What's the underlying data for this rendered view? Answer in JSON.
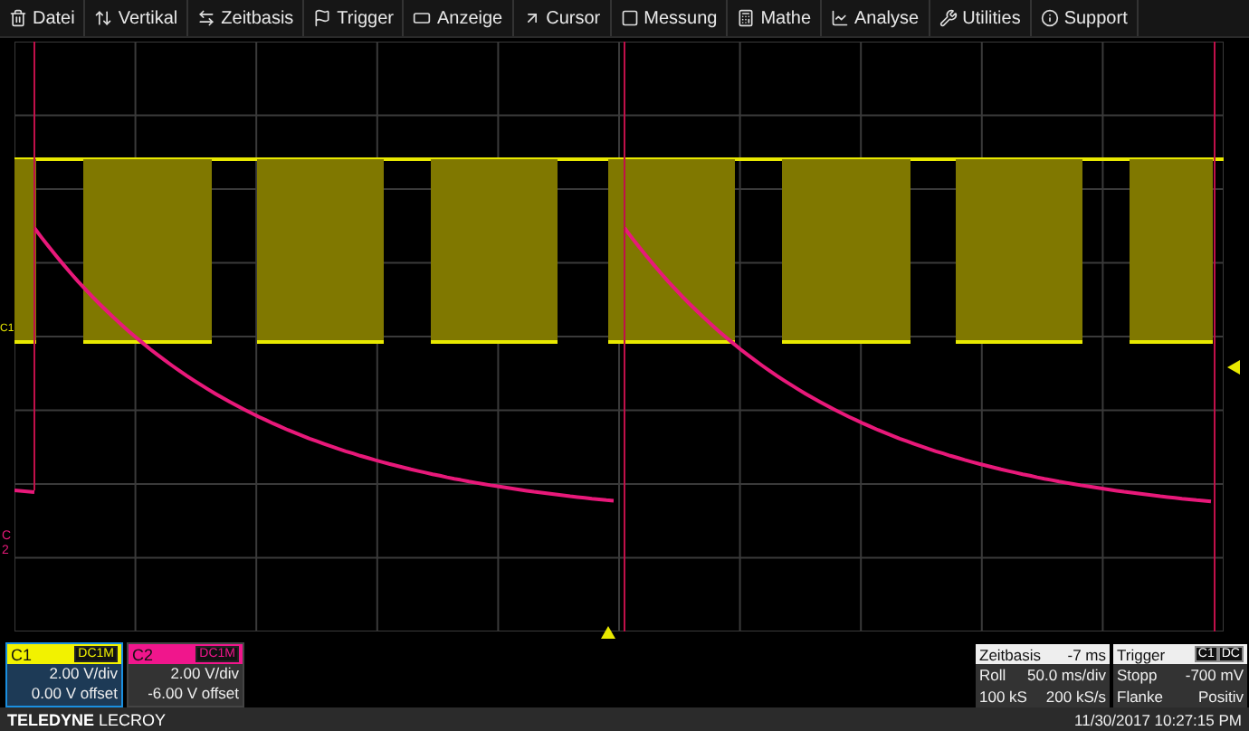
{
  "menu": [
    {
      "label": "Datei"
    },
    {
      "label": "Vertikal"
    },
    {
      "label": "Zeitbasis"
    },
    {
      "label": "Trigger"
    },
    {
      "label": "Anzeige"
    },
    {
      "label": "Cursor"
    },
    {
      "label": "Messung"
    },
    {
      "label": "Mathe"
    },
    {
      "label": "Analyse"
    },
    {
      "label": "Utilities"
    },
    {
      "label": "Support"
    }
  ],
  "trace_labels": [
    {
      "label": "C1",
      "color": "#e8e800"
    },
    {
      "label": "C2",
      "color": "#e8197a"
    }
  ],
  "channels": [
    {
      "name": "C1",
      "coupling": "DC1M",
      "scale": "2.00 V/div",
      "offset": "0.00 V offset",
      "color": "#f2f200",
      "selected": true
    },
    {
      "name": "C2",
      "coupling": "DC1M",
      "scale": "2.00 V/div",
      "offset": "-6.00 V offset",
      "color": "#f0168c",
      "selected": false
    }
  ],
  "timebase": {
    "title": "Zeitbasis",
    "delay": "-7 ms",
    "mode": "Roll",
    "scale": "50.0 ms/div",
    "samples": "100 kS",
    "rate": "200 kS/s"
  },
  "trigger": {
    "title": "Trigger",
    "source": "C1",
    "coupling": "DC",
    "state": "Stopp",
    "level": "-700 mV",
    "type": "Flanke",
    "slope": "Positiv"
  },
  "footer": {
    "brand": "**TELEDYNE** LECROY",
    "datetime": "11/30/2017 10:27:15 PM"
  }
}
